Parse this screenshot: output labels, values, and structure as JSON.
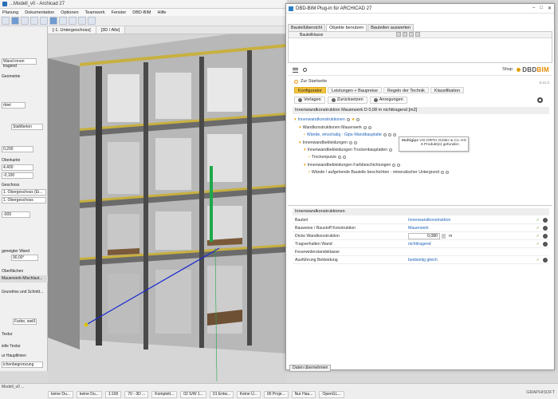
{
  "app": {
    "title": "...Modell_v0 - Archicad 27",
    "menu": [
      "Planung",
      "Dokumentation",
      "Optionen",
      "Teamwork",
      "Fenster",
      "DBD-BIM",
      "Hilfe"
    ],
    "tabs": [
      "[-1. Untergeschoss]",
      "[3D / Alle]"
    ]
  },
  "infobox": {
    "wall_type": "Wand innen tragend",
    "geometry_label": "Geometrie",
    "geometry_value": "rbiet",
    "material": "Stahlbeton",
    "height_value": "0,200",
    "offset_label": "Oberkante",
    "offset_value": "4,400",
    "offset2_value": "-0,100",
    "story_label": "Geschoss",
    "story1": "1. Obergeschoss (Ei...",
    "story2": "1. Obergeschoss",
    "field_value": "-009",
    "angle_value": "90,00°",
    "tilted_label": "geneigter Wand",
    "surface_label": "Oberflächen",
    "surface_value": "Mauerwerk-Mischlast...",
    "section_label": "Grundriss und Schnitt...",
    "color_label": "Farbe, weiß",
    "texture_label": "Textur",
    "texture2_label": "ielle Textur",
    "profile_label": "ur Hauptlinien",
    "bottom_value": "ichenbegrenzung"
  },
  "plugin": {
    "title": "DBD-BIM Plug-in für ARCHICAD 27",
    "tabs": [
      "Bauteilübersicht",
      "Objekte benutzen",
      "Bauteilen auswerten"
    ],
    "table_head": "Bauteilklasse",
    "shop": "Shop",
    "logo_dbd": "DBD",
    "logo_bim": "BIM",
    "home": "Zur Startseite",
    "version": "8.21.0",
    "subtabs": [
      "Konfigurator",
      "Leistungen + Baupreise",
      "Regeln der Technik",
      "Klassifikation"
    ],
    "actions": [
      "Vorlagen",
      "Zurücksetzen",
      "Anregungen"
    ],
    "heading": "Innenwandkonstruktion Mauerwerk D 0,08 m nichttragend [m2]",
    "tree": [
      "Innenwandkonstruktionen",
      "Wandkonstruktionen Mauerwerk",
      "Wände, einschalig - Gips-Wandbauplatte",
      "Innenwandbekleidungen",
      "Innenwandbekleidungen Trockenbauplatten",
      "Trockenputze",
      "Innenwandbekleidungen Farbbeschichtungen",
      "Wände / aufgehende Bauteile beschichten - mineralischer Untergrund"
    ],
    "tooltip_l1": "VG-ORTH GmbH & Co. KG",
    "tooltip_l2": "6 Produkt(e) gefunden",
    "tooltip_brand": "Multigips",
    "props_header": "Innenwandkonstruktionen",
    "props": [
      {
        "label": "Bauteil",
        "value": "Innenwandkonstruktion"
      },
      {
        "label": "Bauweise / Baustoff Konstruktion",
        "value": "Mauerwerk"
      },
      {
        "label": "Dicke Wandkonstruktion",
        "value": "0,080",
        "unit": "m"
      },
      {
        "label": "Tragverhalten Wand",
        "value": "nichttragend"
      },
      {
        "label": "Feuerwiderstandsklasse",
        "value": ""
      },
      {
        "label": "Ausführung Bekleidung",
        "value": "beidseitig gleich"
      }
    ],
    "apply_label": "Daten übernehmen"
  },
  "status": {
    "top": "Modell_v0 ...",
    "items": [
      "keine Du...",
      "keine Du...",
      "1:100",
      "70 - 3D ...",
      "Komplett...",
      "02 S/W 1...",
      "01 Entw...",
      "Keine Ü...",
      "00 Proje...",
      "Nur Hau...",
      "OpenGL..."
    ],
    "brand": "GRAPHISOFT"
  },
  "colors": {
    "accent": "#f3c33d",
    "link": "#2266bb",
    "logo": "#e58a00",
    "ok": "#5aa02c"
  }
}
